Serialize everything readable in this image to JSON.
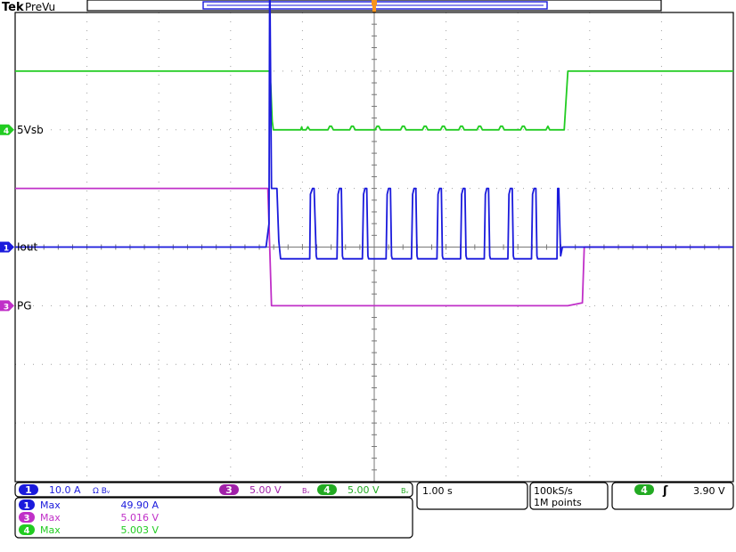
{
  "header": {
    "brand": "Tek",
    "mode": "PreVu"
  },
  "colors": {
    "ch1": "#1a1adc",
    "ch3": "#c030c8",
    "ch4": "#22cc22",
    "grid": "#a0a0a0",
    "frame": "#000000"
  },
  "chart_data": {
    "type": "line",
    "x_unit": "div",
    "xlim": [
      0,
      10
    ],
    "ylim": [
      -4,
      4
    ],
    "series": [
      {
        "name": "5Vsb",
        "color": "#22cc22",
        "x": [
          0,
          7.0,
          7.03,
          7.07,
          7.1,
          7.15,
          7.25,
          7.85,
          7.88,
          7.9,
          7.95,
          8.0,
          8.05,
          8.1,
          8.15,
          8.5,
          8.6,
          8.65,
          8.7,
          8.75,
          9.2,
          9.25,
          9.3,
          9.35,
          9.9,
          9.95,
          10.0,
          10.05,
          10.1,
          10.5,
          10.6,
          10.65,
          10.7,
          10.75,
          11.2,
          11.25,
          11.3,
          11.35,
          11.7,
          11.75,
          11.8,
          11.85,
          12.2,
          12.25,
          12.3,
          12.35,
          12.7,
          12.75,
          12.8,
          12.85,
          13.3,
          13.35,
          13.4,
          13.45,
          13.9,
          13.95,
          14.0,
          14.05,
          14.6,
          14.65,
          14.7,
          15.1,
          15.2,
          19.75
        ],
        "y": [
          3.0,
          3.0,
          2.75,
          2.15,
          2.0,
          2.0,
          2.0,
          2.0,
          2.05,
          2.0,
          2.0,
          2.0,
          2.05,
          2.0,
          2.0,
          2.0,
          2.0,
          2.06,
          2.06,
          2.0,
          2.0,
          2.06,
          2.06,
          2.0,
          2.0,
          2.06,
          2.06,
          2.0,
          2.0,
          2.0,
          2.0,
          2.06,
          2.06,
          2.0,
          2.0,
          2.06,
          2.06,
          2.0,
          2.0,
          2.06,
          2.06,
          2.0,
          2.0,
          2.06,
          2.06,
          2.0,
          2.0,
          2.06,
          2.06,
          2.0,
          2.0,
          2.06,
          2.06,
          2.0,
          2.0,
          2.06,
          2.06,
          2.0,
          2.0,
          2.06,
          2.0,
          2.0,
          3.0,
          3.0
        ]
      },
      {
        "name": "PG",
        "color": "#c030c8",
        "x": [
          0,
          6.95,
          7.0,
          7.05,
          15.2,
          15.6,
          15.65,
          19.75
        ],
        "y": [
          2.0,
          2.0,
          1.0,
          0.0,
          0.0,
          0.05,
          1.0,
          1.0
        ],
        "y_offset_div": -1.0
      },
      {
        "name": "Iout",
        "color": "#1a1adc",
        "x": [
          0,
          6.9,
          6.98,
          7.0,
          7.05,
          7.12,
          7.2,
          7.25,
          7.3,
          7.35,
          7.4,
          8.1,
          8.12,
          8.18,
          8.22,
          8.28,
          8.3,
          8.85,
          8.88,
          8.92,
          8.97,
          9.0,
          9.02,
          9.55,
          9.58,
          9.62,
          9.67,
          9.7,
          9.72,
          10.2,
          10.23,
          10.27,
          10.32,
          10.35,
          10.37,
          10.9,
          10.93,
          10.97,
          11.02,
          11.05,
          11.07,
          11.6,
          11.63,
          11.67,
          11.72,
          11.75,
          11.77,
          12.25,
          12.28,
          12.32,
          12.37,
          12.4,
          12.42,
          12.9,
          12.93,
          12.97,
          13.02,
          13.05,
          13.07,
          13.55,
          13.58,
          13.62,
          13.67,
          13.7,
          13.72,
          14.2,
          14.23,
          14.27,
          14.32,
          14.35,
          14.37,
          14.9,
          14.92,
          14.95,
          15.0,
          15.05,
          19.75
        ],
        "y": [
          0.0,
          0.0,
          0.4,
          4.8,
          1.0,
          1.0,
          1.0,
          0.1,
          -0.2,
          -0.2,
          -0.2,
          -0.2,
          0.9,
          1.0,
          1.0,
          -0.15,
          -0.2,
          -0.2,
          0.9,
          1.0,
          1.0,
          -0.15,
          -0.2,
          -0.2,
          0.9,
          1.0,
          1.0,
          -0.15,
          -0.2,
          -0.2,
          0.9,
          1.0,
          1.0,
          -0.15,
          -0.2,
          -0.2,
          0.9,
          1.0,
          1.0,
          -0.15,
          -0.2,
          -0.2,
          0.9,
          1.0,
          1.0,
          -0.15,
          -0.2,
          -0.2,
          0.9,
          1.0,
          1.0,
          -0.15,
          -0.2,
          -0.2,
          0.9,
          1.0,
          1.0,
          -0.15,
          -0.2,
          -0.2,
          0.9,
          1.0,
          1.0,
          -0.15,
          -0.2,
          -0.2,
          0.9,
          1.0,
          1.0,
          -0.15,
          -0.2,
          -0.2,
          1.0,
          1.0,
          -0.15,
          0.0,
          0.0
        ]
      }
    ],
    "markers": [
      {
        "channel": "4",
        "label": "5Vsb",
        "color": "#22cc22"
      },
      {
        "channel": "3",
        "label": "PG",
        "color": "#c030c8"
      },
      {
        "channel": "1",
        "label": "Iout",
        "color": "#1a1adc"
      }
    ],
    "grid": true
  },
  "status": {
    "ch1": {
      "num": "1",
      "scale": "10.0 A",
      "coupling": "Ω Bᵥ"
    },
    "ch3": {
      "num": "3",
      "scale": "5.00 V",
      "coupling": "Bᵥ"
    },
    "ch4": {
      "num": "4",
      "scale": "5.00 V",
      "coupling": "Bᵥ"
    },
    "timebase": "1.00 s",
    "sample_rate": "100kS/s",
    "record_length": "1M points",
    "trigger": {
      "channel": "4",
      "slope": "ʃ",
      "level": "3.90 V"
    }
  },
  "measurements": [
    {
      "num": "1",
      "label": "Max",
      "value": "49.90 A",
      "color": "#1a1adc"
    },
    {
      "num": "3",
      "label": "Max",
      "value": "5.016 V",
      "color": "#c030c8"
    },
    {
      "num": "4",
      "label": "Max",
      "value": "5.003 V",
      "color": "#22cc22"
    }
  ]
}
